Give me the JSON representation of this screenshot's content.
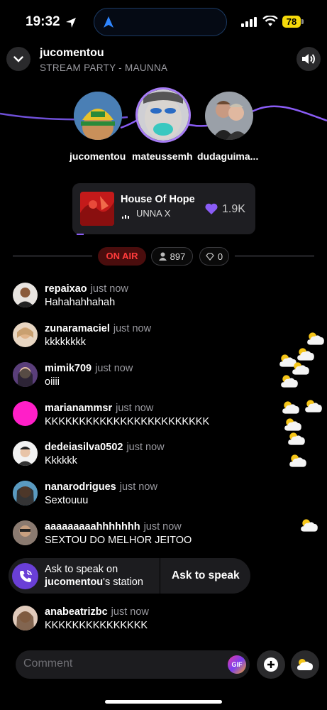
{
  "status_bar": {
    "time": "19:32",
    "battery": "78"
  },
  "header": {
    "title": "jucomentou",
    "subtitle": "STREAM PARTY - MAUNNA"
  },
  "participants": [
    {
      "name": "jucomentou"
    },
    {
      "name": "mateussemh"
    },
    {
      "name": "dudaguima..."
    }
  ],
  "now_playing": {
    "title": "House Of Hope",
    "artist": "UNNA X",
    "likes": "1.9K"
  },
  "live": {
    "on_air": "ON AIR",
    "listeners": "897",
    "gems": "0"
  },
  "comments": [
    {
      "user": "repaixao",
      "time": "just now",
      "text": "Hahahahhahah"
    },
    {
      "user": "zunaramaciel",
      "time": "just now",
      "text": "kkkkkkkk"
    },
    {
      "user": "mimik709",
      "time": "just now",
      "text": "oiiii"
    },
    {
      "user": "marianammsr",
      "time": "just now",
      "text": "KKKKKKKKKKKKKKKKKKKKKKKK"
    },
    {
      "user": "dedeiasilva0502",
      "time": "just now",
      "text": "Kkkkkk"
    },
    {
      "user": "nanarodrigues",
      "time": "just now",
      "text": "Sextouuu"
    },
    {
      "user": "aaaaaaaaahhhhhhh",
      "time": "just now",
      "text": "SEXTOU DO MELHOR JEITOO"
    },
    {
      "user": "anabeatrizbc",
      "time": "just now",
      "text": "KKKKKKKKKKKKKKK"
    }
  ],
  "ask_to_speak": {
    "line1": "Ask to speak on",
    "station": "jucomentou",
    "suffix": "'s station",
    "button": "Ask to speak"
  },
  "composer": {
    "placeholder": "Comment",
    "gif": "GIF"
  },
  "colors": {
    "accent": "#8a5cf6",
    "on_air": "#ff3b3b",
    "battery": "#f5d90a"
  },
  "icons": [
    "location-arrow-icon",
    "navigation-icon",
    "signal-icon",
    "wifi-icon",
    "chevron-down-icon",
    "speaker-icon",
    "heart-icon",
    "person-icon",
    "diamond-icon",
    "phone-call-icon",
    "plus-icon",
    "cloud-sun-icon"
  ]
}
